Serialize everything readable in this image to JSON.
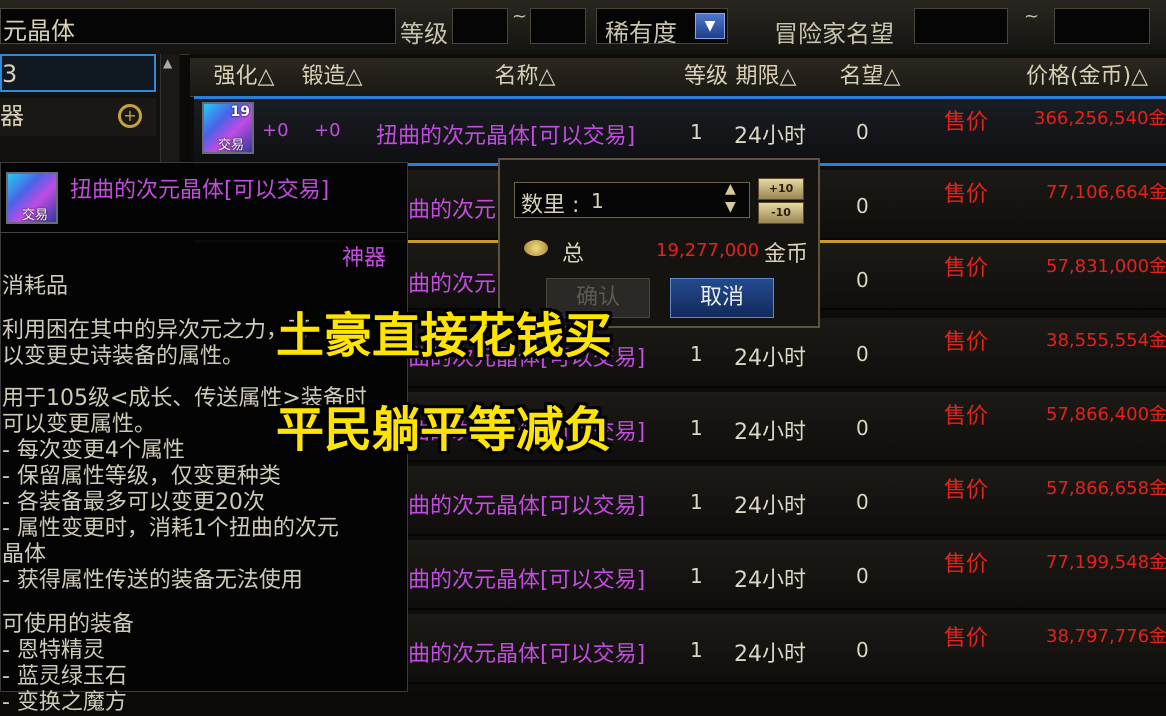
{
  "search": {
    "name_value": "元晶体",
    "level_label": "等级",
    "tilde": "~",
    "rarity_label": "稀有度",
    "adventurer_label": "冒险家名望",
    "tilde2": "~"
  },
  "categories": [
    {
      "label": "3",
      "selected": true
    },
    {
      "label": "器",
      "icon": "magnifier-plus-icon"
    }
  ],
  "table": {
    "headers": {
      "enhance": "强化△",
      "forge": "锻造△",
      "name": "名称△",
      "level": "等级",
      "period": "期限△",
      "fame": "名望△",
      "price": "价格(金币)△"
    },
    "rows": [
      {
        "enhance": "+0",
        "forge": "+0",
        "name": "扭曲的次元晶体[可以交易]",
        "level": "1",
        "period": "24小时",
        "fame": "0",
        "sell": "售价",
        "price": "366,256,540金"
      },
      {
        "name": "曲的次元晶体[可以交易]",
        "fame": "0",
        "sell": "售价",
        "price": "77,106,664金"
      },
      {
        "name": "曲的次元晶体[可以交易]",
        "fame": "0",
        "sell": "售价",
        "price": "57,831,000金"
      },
      {
        "name": "曲的次元晶体[可以交易]",
        "level": "1",
        "period": "24小时",
        "fame": "0",
        "sell": "售价",
        "price": "38,555,554金"
      },
      {
        "name": "曲的次元晶体[可以交易]",
        "level": "1",
        "period": "24小时",
        "fame": "0",
        "sell": "售价",
        "price": "57,866,400金"
      },
      {
        "name": "曲的次元晶体[可以交易]",
        "level": "1",
        "period": "24小时",
        "fame": "0",
        "sell": "售价",
        "price": "57,866,658金"
      },
      {
        "name": "曲的次元晶体[可以交易]",
        "level": "1",
        "period": "24小时",
        "fame": "0",
        "sell": "售价",
        "price": "77,199,548金"
      },
      {
        "name": "曲的次元晶体[可以交易]",
        "level": "1",
        "period": "24小时",
        "fame": "0",
        "sell": "售价",
        "price": "38,797,776金"
      }
    ],
    "first_icon": {
      "count": "19",
      "trade": "交易"
    }
  },
  "tooltip": {
    "title": "扭曲的次元晶体[可以交易]",
    "icon_trade": "交易",
    "rarity": "神器",
    "type": "消耗品",
    "lines": [
      "利用困在其中的异次元之力，可",
      "以变更史诗装备的属性。",
      "",
      "用于105级<成长、传送属性>装备时",
      "可以变更属性。",
      "- 每次变更4个属性",
      "- 保留属性等级，仅变更种类",
      "- 各装备最多可以变更20次",
      "- 属性变更时，消耗1个扭曲的次元",
      "晶体",
      "- 获得属性传送的装备无法使用",
      "",
      "可使用的装备",
      "- 恩特精灵",
      "- 蓝灵绿玉石",
      "- 变换之魔方"
    ]
  },
  "dialog": {
    "qty_label": "数里 :",
    "qty_value": "1",
    "plus10": "+10",
    "minus10": "-10",
    "total_label": "总",
    "total_value": "19,277,000",
    "currency": "金币",
    "confirm": "确认",
    "cancel": "取消"
  },
  "overlay": {
    "line1": "土豪直接花钱买",
    "line2": "平民躺平等减负"
  }
}
